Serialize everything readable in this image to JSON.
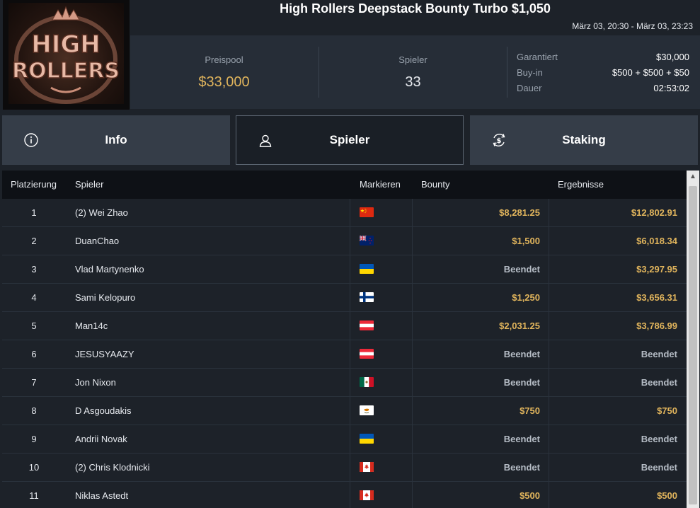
{
  "logo": {
    "line1": "HIGH",
    "line2": "ROLLERS"
  },
  "header": {
    "title": "High Rollers Deepstack Bounty Turbo $1,050",
    "dates": "März 03, 20:30 - März 03, 23:23"
  },
  "stats": {
    "prize_label": "Preispool",
    "prize_value": "$33,000",
    "players_label": "Spieler",
    "players_value": "33",
    "guaranteed_label": "Garantiert",
    "guaranteed_value": "$30,000",
    "buyin_label": "Buy-in",
    "buyin_value": "$500 + $500 + $50",
    "duration_label": "Dauer",
    "duration_value": "02:53:02"
  },
  "tabs": [
    {
      "label": "Info",
      "icon": "info-icon"
    },
    {
      "label": "Spieler",
      "icon": "user-icon"
    },
    {
      "label": "Staking",
      "icon": "dollar-refresh-icon"
    }
  ],
  "table": {
    "columns": [
      "Platzierung",
      "Spieler",
      "Markieren",
      "Bounty",
      "Ergebnisse"
    ],
    "rows": [
      {
        "place": "1",
        "player": "(2) Wei Zhao",
        "flag": "china",
        "bounty": "$8,281.25",
        "result": "$12,802.91"
      },
      {
        "place": "2",
        "player": "DuanChao",
        "flag": "new-zealand",
        "bounty": "$1,500",
        "result": "$6,018.34"
      },
      {
        "place": "3",
        "player": "Vlad Martynenko",
        "flag": "ukraine",
        "bounty": "Beendet",
        "result": "$3,297.95"
      },
      {
        "place": "4",
        "player": "Sami Kelopuro",
        "flag": "finland",
        "bounty": "$1,250",
        "result": "$3,656.31"
      },
      {
        "place": "5",
        "player": "Man14c",
        "flag": "austria",
        "bounty": "$2,031.25",
        "result": "$3,786.99"
      },
      {
        "place": "6",
        "player": "JESUSYAAZY",
        "flag": "austria",
        "bounty": "Beendet",
        "result": "Beendet"
      },
      {
        "place": "7",
        "player": "Jon Nixon",
        "flag": "mexico",
        "bounty": "Beendet",
        "result": "Beendet"
      },
      {
        "place": "8",
        "player": "D Asgoudakis",
        "flag": "cyprus",
        "bounty": "$750",
        "result": "$750"
      },
      {
        "place": "9",
        "player": "Andrii Novak",
        "flag": "ukraine",
        "bounty": "Beendet",
        "result": "Beendet"
      },
      {
        "place": "10",
        "player": "(2) Chris Klodnicki",
        "flag": "canada",
        "bounty": "Beendet",
        "result": "Beendet"
      },
      {
        "place": "11",
        "player": "Niklas Astedt",
        "flag": "canada",
        "bounty": "$500",
        "result": "$500"
      }
    ]
  },
  "colors": {
    "gold": "#e0b45c",
    "background": "#1d2229",
    "panel": "#262d37"
  }
}
